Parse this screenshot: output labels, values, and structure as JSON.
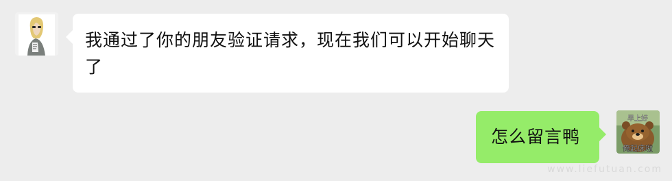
{
  "conversation": {
    "messages": [
      {
        "side": "left",
        "text": "我通过了你的朋友验证请求，现在我们可以开始聊天了",
        "avatar_icon": "user-photo-avatar"
      },
      {
        "side": "right",
        "text": "怎么留言鸭",
        "avatar_icon": "bear-sticker-avatar"
      }
    ]
  },
  "avatar_right": {
    "caption_top": "早上好",
    "caption_bottom": "俺起床啦"
  },
  "watermark": "www.liefutuan.com",
  "colors": {
    "background": "#ededed",
    "incoming_bubble": "#ffffff",
    "outgoing_bubble": "#95ec69",
    "text": "#111111"
  }
}
